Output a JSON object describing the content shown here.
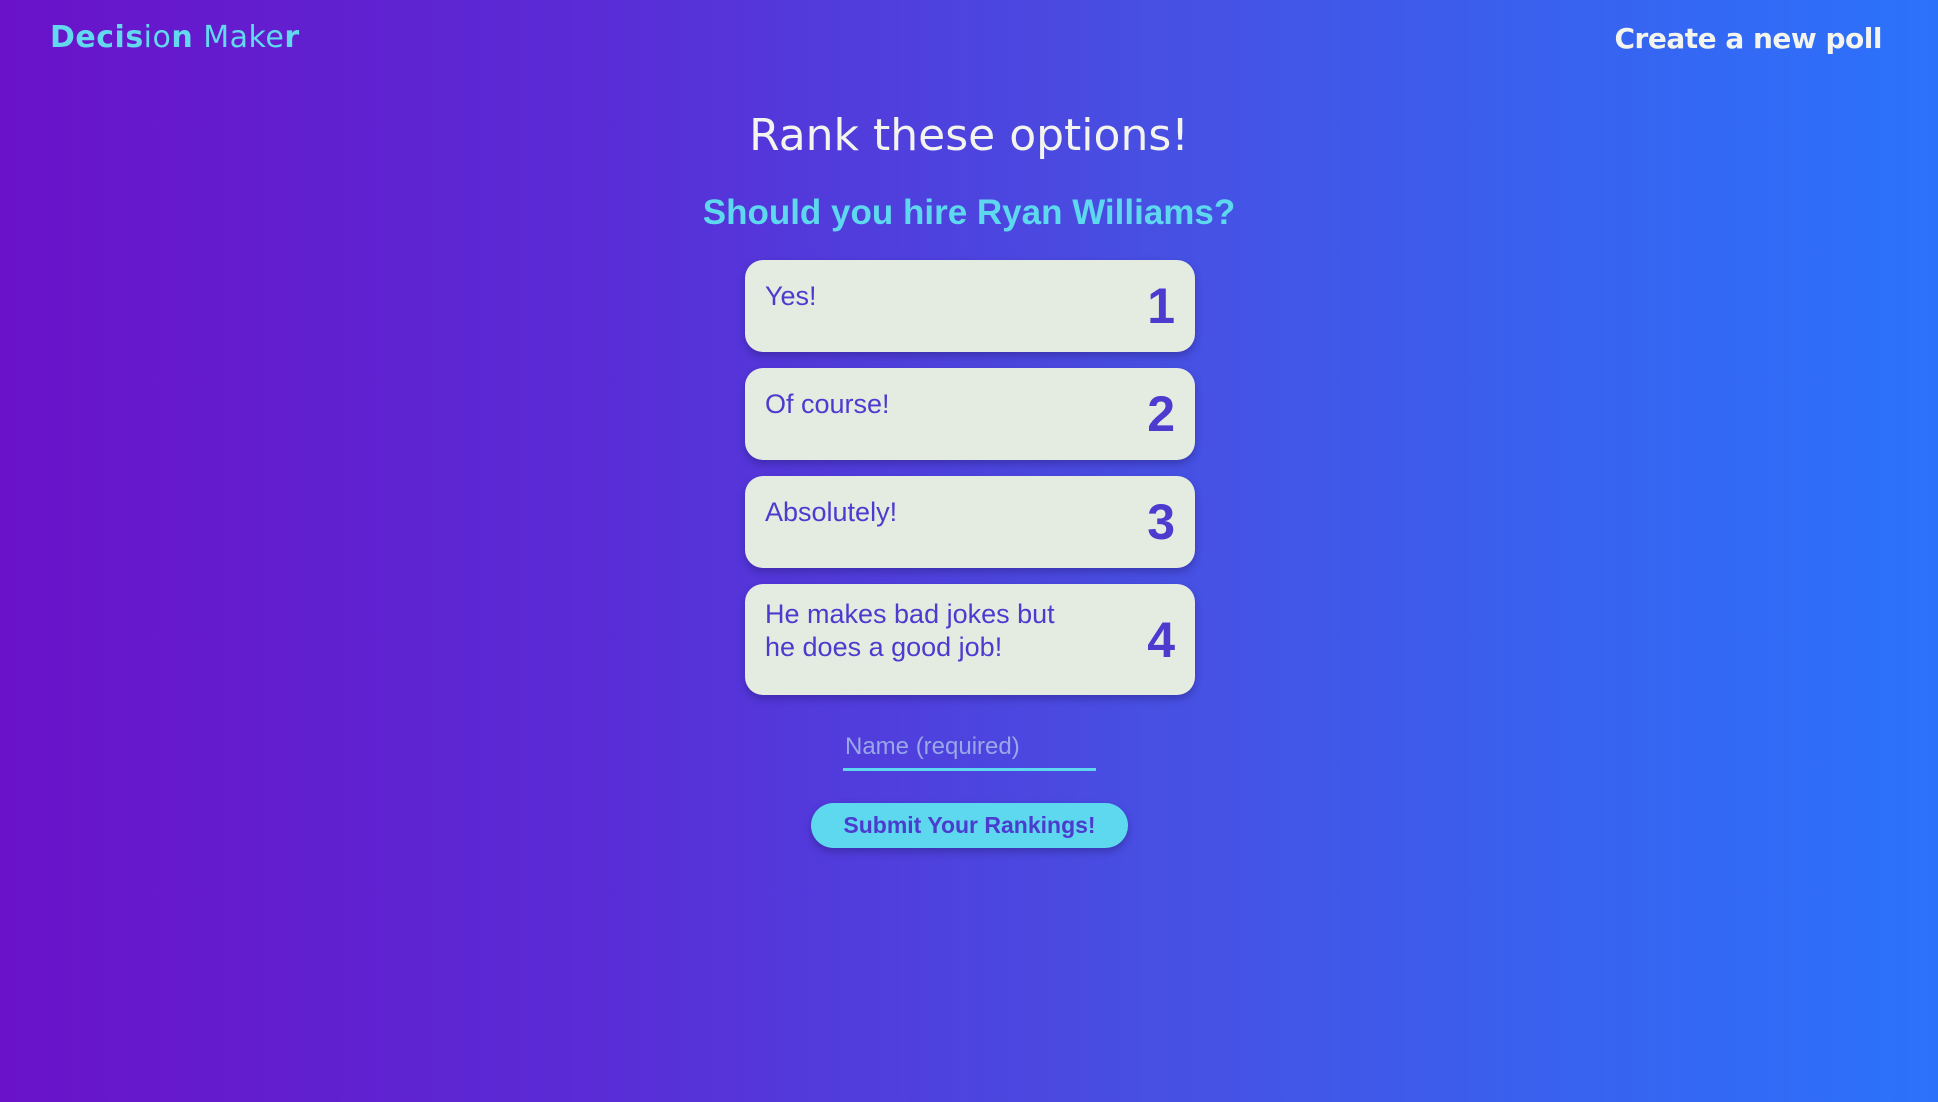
{
  "header": {
    "logo_part1": "Decis",
    "logo_part2": "io",
    "logo_part3": "n",
    "logo_part4": " Mak",
    "logo_part5": "e",
    "logo_part6": "r",
    "create_link": "Create a new poll"
  },
  "main": {
    "title": "Rank these options!",
    "question": "Should you hire Ryan Williams?",
    "options": [
      {
        "text": "Yes!",
        "rank": "1"
      },
      {
        "text": "Of course!",
        "rank": "2"
      },
      {
        "text": "Absolutely!",
        "rank": "3"
      },
      {
        "text": "He makes bad jokes but he does a good job!",
        "rank": "4"
      }
    ],
    "name_placeholder": "Name (required)",
    "name_value": "",
    "submit_label": "Submit Your Rankings!"
  },
  "colors": {
    "gradient_start": "#6a12c9",
    "gradient_end": "#2b72fb",
    "accent_cyan": "#5ed8ee",
    "card_bg": "#e4ebe0",
    "card_text": "#4b3bcf",
    "heading_text": "#f3f4ee"
  }
}
